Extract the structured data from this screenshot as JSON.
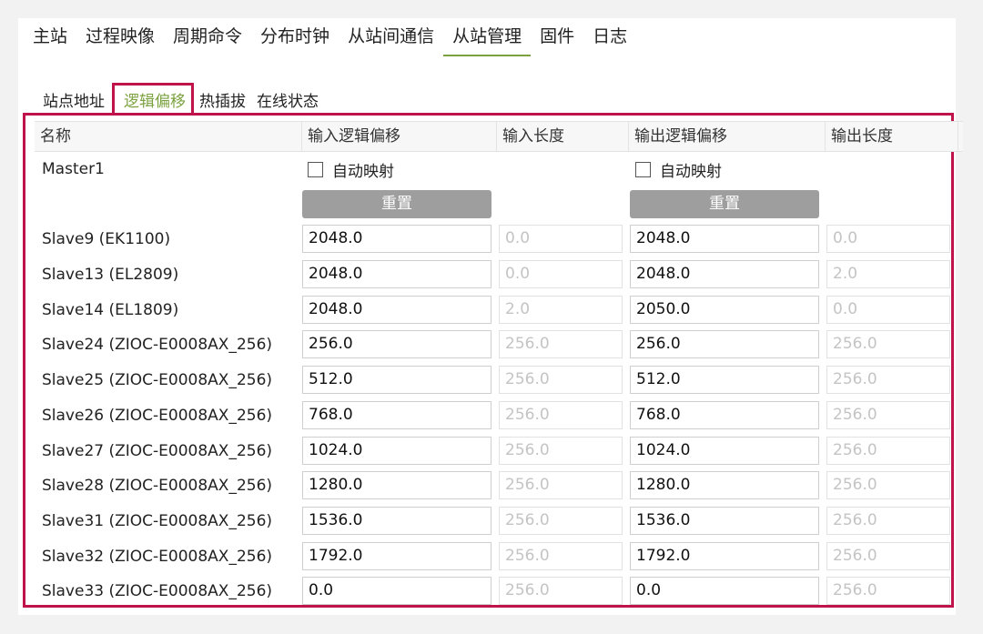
{
  "nav": {
    "items": [
      "主站",
      "过程映像",
      "周期命令",
      "分布时钟",
      "从站间通信",
      "从站管理",
      "固件",
      "日志"
    ],
    "active_index": 5
  },
  "subtabs": {
    "items": [
      "站点地址",
      "逻辑偏移",
      "热插拔",
      "在线状态"
    ],
    "active_index": 1
  },
  "colors": {
    "accent": "#7ba23f",
    "highlight_border": "#c0134a",
    "button": "#9e9e9e"
  },
  "table": {
    "headers": [
      "名称",
      "输入逻辑偏移",
      "输入长度",
      "输出逻辑偏移",
      "输出长度"
    ],
    "master": {
      "name": "Master1",
      "input_auto_map_label": "自动映射",
      "output_auto_map_label": "自动映射",
      "input_reset_label": "重置",
      "output_reset_label": "重置",
      "input_auto_map_checked": false,
      "output_auto_map_checked": false
    },
    "rows": [
      {
        "name": "Slave9 (EK1100)",
        "in_offset": "2048.0",
        "in_len": "0.0",
        "out_offset": "2048.0",
        "out_len": "0.0"
      },
      {
        "name": "Slave13 (EL2809)",
        "in_offset": "2048.0",
        "in_len": "0.0",
        "out_offset": "2048.0",
        "out_len": "2.0"
      },
      {
        "name": "Slave14 (EL1809)",
        "in_offset": "2048.0",
        "in_len": "2.0",
        "out_offset": "2050.0",
        "out_len": "0.0"
      },
      {
        "name": "Slave24 (ZIOC-E0008AX_256)",
        "in_offset": "256.0",
        "in_len": "256.0",
        "out_offset": "256.0",
        "out_len": "256.0"
      },
      {
        "name": "Slave25 (ZIOC-E0008AX_256)",
        "in_offset": "512.0",
        "in_len": "256.0",
        "out_offset": "512.0",
        "out_len": "256.0"
      },
      {
        "name": "Slave26 (ZIOC-E0008AX_256)",
        "in_offset": "768.0",
        "in_len": "256.0",
        "out_offset": "768.0",
        "out_len": "256.0"
      },
      {
        "name": "Slave27 (ZIOC-E0008AX_256)",
        "in_offset": "1024.0",
        "in_len": "256.0",
        "out_offset": "1024.0",
        "out_len": "256.0"
      },
      {
        "name": "Slave28 (ZIOC-E0008AX_256)",
        "in_offset": "1280.0",
        "in_len": "256.0",
        "out_offset": "1280.0",
        "out_len": "256.0"
      },
      {
        "name": "Slave31 (ZIOC-E0008AX_256)",
        "in_offset": "1536.0",
        "in_len": "256.0",
        "out_offset": "1536.0",
        "out_len": "256.0"
      },
      {
        "name": "Slave32 (ZIOC-E0008AX_256)",
        "in_offset": "1792.0",
        "in_len": "256.0",
        "out_offset": "1792.0",
        "out_len": "256.0"
      },
      {
        "name": "Slave33 (ZIOC-E0008AX_256)",
        "in_offset": "0.0",
        "in_len": "256.0",
        "out_offset": "0.0",
        "out_len": "256.0"
      }
    ]
  }
}
